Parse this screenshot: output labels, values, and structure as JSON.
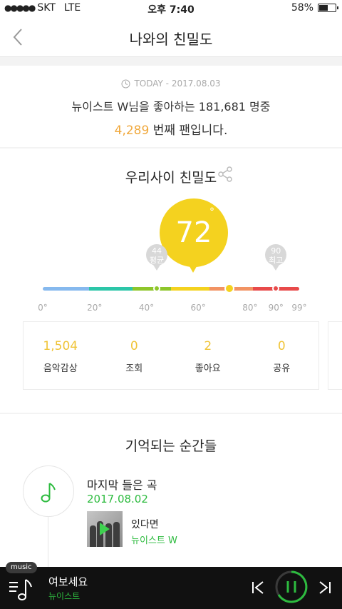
{
  "status_bar": {
    "carrier": "SKT",
    "network": "LTE",
    "time": "오후 7:40",
    "battery": "58%",
    "battery_level": 0.58
  },
  "nav": {
    "title": "나와의 친밀도",
    "back_icon": "chevron-left-icon"
  },
  "fan_info": {
    "date_label": "TODAY - 2017.08.03",
    "line1": "뉴이스트 W님을 좋아하는 181,681 명중",
    "rank": "4,289",
    "line2_suffix": " 번째 팬입니다."
  },
  "intimacy": {
    "title": "우리사이 친밀도",
    "share_icon": "share-icon",
    "score": "72",
    "degree_symbol": "°",
    "average": {
      "value": "44",
      "label": "평균"
    },
    "highest": {
      "value": "90",
      "label": "최고"
    },
    "scale_ticks": [
      "0°",
      "20°",
      "40°",
      "60°",
      "80°",
      "90°",
      "99°"
    ],
    "scale_tick_values": [
      0,
      20,
      40,
      60,
      80,
      90,
      99
    ],
    "colors": {
      "score_bubble": "#f4d21f",
      "avg_marker": "#8ec62a",
      "max_marker": "#e84a4a",
      "accent_green": "#2dbb3f"
    }
  },
  "stats": [
    {
      "value": "1,504",
      "label": "음악감상"
    },
    {
      "value": "0",
      "label": "조회"
    },
    {
      "value": "2",
      "label": "좋아요"
    },
    {
      "value": "0",
      "label": "공유"
    }
  ],
  "moments": {
    "title": "기억되는 순간들",
    "note_icon": "music-note-icon",
    "item_label": "마지막 들은 곡",
    "item_date": "2017.08.02",
    "song": {
      "title": "있다면",
      "artist": "뉴이스트 W"
    }
  },
  "player": {
    "badge": "music",
    "title": "여보세요",
    "artist": "뉴이스트",
    "icons": [
      "playlist-icon",
      "previous-icon",
      "pause-icon",
      "next-icon"
    ]
  }
}
